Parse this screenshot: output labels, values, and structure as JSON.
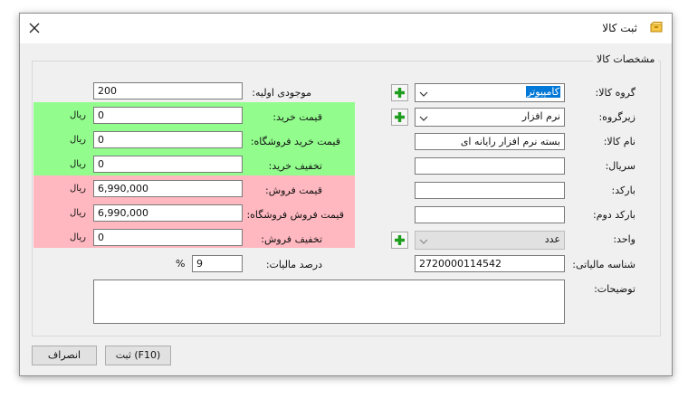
{
  "window": {
    "title": "ثبت کالا"
  },
  "groupbox": {
    "title": "مشخصات کالا"
  },
  "right_form": {
    "group_label": "گروه کالا:",
    "group_value": "کامپیوتر",
    "subgroup_label": "زیرگروه:",
    "subgroup_value": "نرم افزار",
    "name_label": "نام کالا:",
    "name_value": "بسته نرم افزار رایانه ای",
    "serial_label": "سریال:",
    "serial_value": "",
    "barcode_label": "بارکد:",
    "barcode_value": "",
    "barcode2_label": "بارکد دوم:",
    "barcode2_value": "",
    "unit_label": "واحد:",
    "unit_value": "عدد",
    "tax_id_label": "شناسه مالیاتی:",
    "tax_id_value": "2720000114542",
    "notes_label": "توضیحات:",
    "notes_value": ""
  },
  "left_form": {
    "initial_stock_label": "موجودی اولیه:",
    "initial_stock_value": "200",
    "purchase_price_label": "قیمت خرید:",
    "purchase_price_value": "0",
    "store_purchase_price_label": "قیمت خرید فروشگاه:",
    "store_purchase_price_value": "0",
    "purchase_discount_label": "تخفیف خرید:",
    "purchase_discount_value": "0",
    "sale_price_label": "قیمت فروش:",
    "sale_price_value": "6,990,000",
    "store_sale_price_label": "قیمت فروش فروشگاه:",
    "store_sale_price_value": "6,990,000",
    "sale_discount_label": "تخفیف فروش:",
    "sale_discount_value": "0",
    "tax_percent_label": "درصد مالیات:",
    "tax_percent_value": "9",
    "percent_sign": "%",
    "currency": "ریال"
  },
  "buttons": {
    "submit_label": "ثبت (F10)",
    "cancel_label": "انصراف"
  },
  "colors": {
    "purchase_band": "#92fd8d",
    "sale_band": "#ffb8c0",
    "add_icon": "#1f9d1f",
    "selection": "#0078d7"
  },
  "icons": {
    "close": "close-icon",
    "add": "plus-icon",
    "dropdown": "chevron-down-icon",
    "app": "box-icon"
  }
}
